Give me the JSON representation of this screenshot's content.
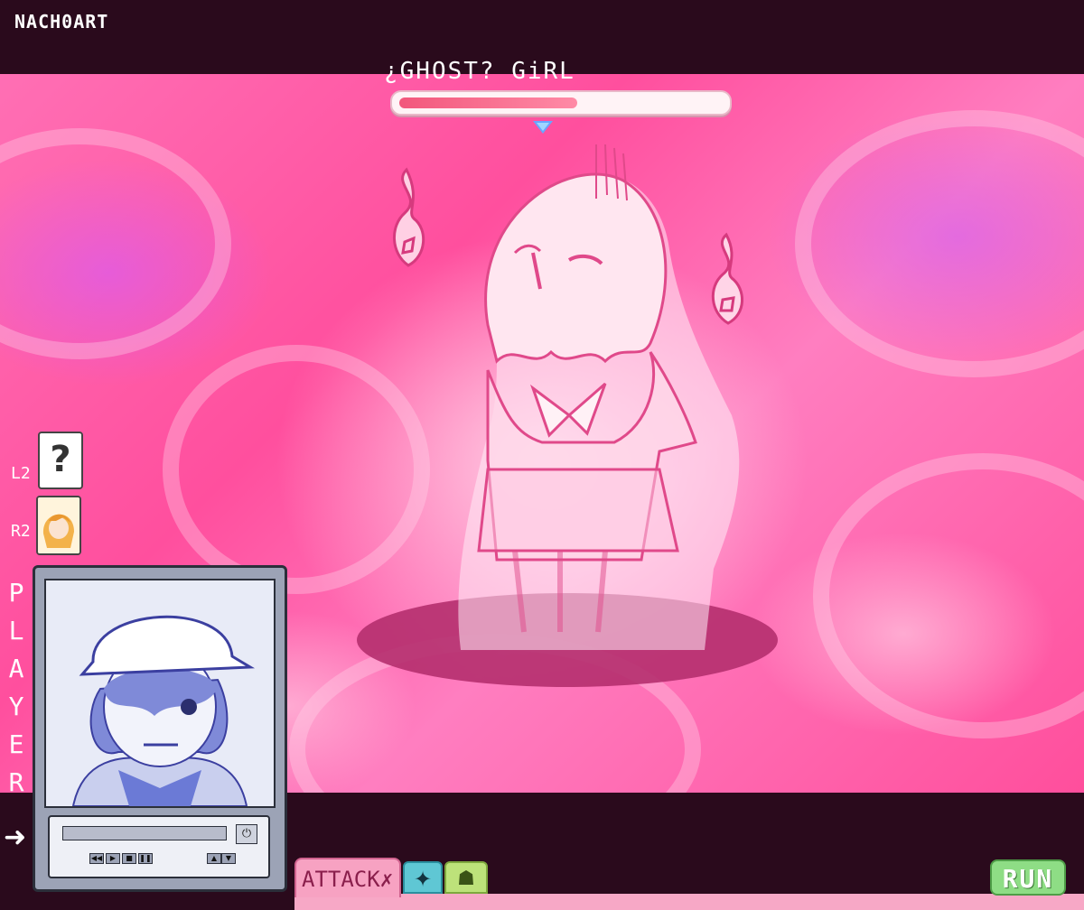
{
  "credit": "NACH0ART",
  "enemy": {
    "name": "¿GHOST? GiRL",
    "hp_fraction": 0.55
  },
  "side_buttons": {
    "l2_label": "L2",
    "l2_icon": "?",
    "r2_label": "R2"
  },
  "player_label": [
    "P",
    "L",
    "A",
    "Y",
    "E",
    "R"
  ],
  "arrow_icon": "➜",
  "tv_power_icon": "⏻",
  "menu": {
    "attack_label": "ATTACK",
    "attack_icon": "✗",
    "skill_icon": "✦",
    "item_icon": "☗",
    "run_label": "RUN"
  },
  "colors": {
    "arena_pink": "#ff5aa8",
    "frame_dark": "#2a0a1c",
    "run_green": "#8edd85",
    "hp_red": "#f2577c"
  }
}
